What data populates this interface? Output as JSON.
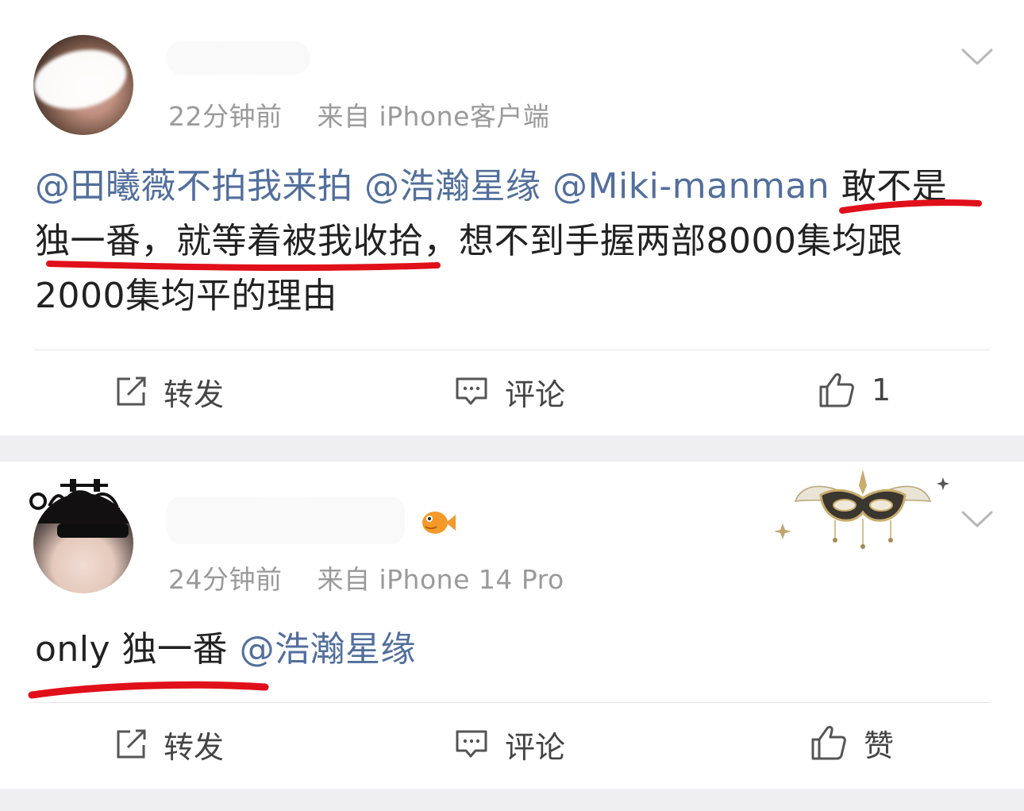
{
  "posts": [
    {
      "time": "22分钟前",
      "source": "来自 iPhone客户端",
      "content": {
        "mention1": "@田曦薇不拍我来拍",
        "mention2": "@浩瀚星缘",
        "mention3": "@Miki-manman",
        "text_line1_tail": "敢不是",
        "text_line2": "独一番，就等着被我收拾，想不到手握两部8000集均跟",
        "text_line3": "2000集均平的理由"
      },
      "actions": {
        "repost_label": "转发",
        "comment_label": "评论",
        "like_label": "1"
      }
    },
    {
      "time": "24分钟前",
      "source": "来自 iPhone 14 Pro",
      "content": {
        "text": "only 独一番",
        "mention": "@浩瀚星缘"
      },
      "actions": {
        "repost_label": "转发",
        "comment_label": "评论",
        "like_label": "赞"
      }
    }
  ],
  "colors": {
    "mention": "#526f9c",
    "meta": "#9a9a9a",
    "highlight_underline": "#e0101a",
    "separator": "#efeff1"
  },
  "icons": {
    "repost": "edit-share-icon",
    "comment": "comment-bubble-icon",
    "like": "thumbs-up-icon",
    "more": "chevron-down-icon"
  }
}
